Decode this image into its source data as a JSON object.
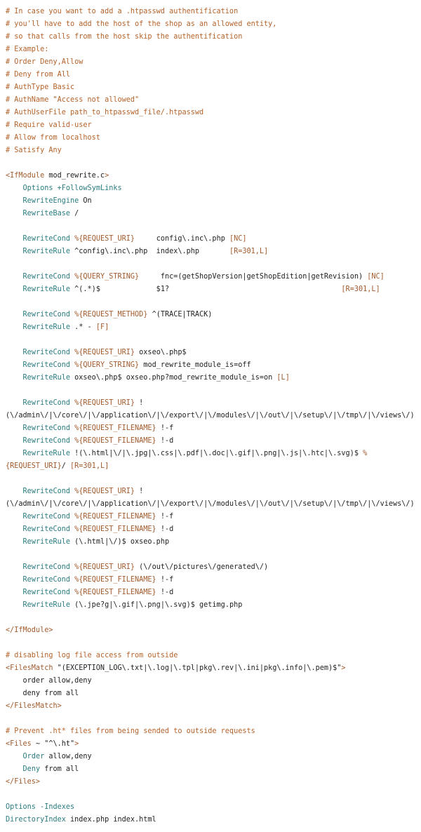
{
  "code_lines": [
    [
      [
        "c",
        "# In case you want to add a .htpasswd authentification"
      ]
    ],
    [
      [
        "c",
        "# you'll have to add the host of the shop as an allowed entity,"
      ]
    ],
    [
      [
        "c",
        "# so that calls from the host skip the authentification"
      ]
    ],
    [
      [
        "c",
        "# Example:"
      ]
    ],
    [
      [
        "c",
        "# Order Deny,Allow"
      ]
    ],
    [
      [
        "c",
        "# Deny from All"
      ]
    ],
    [
      [
        "c",
        "# AuthType Basic"
      ]
    ],
    [
      [
        "c",
        "# AuthName \"Access not allowed\""
      ]
    ],
    [
      [
        "c",
        "# AuthUserFile path_to_htpasswd_file/.htpasswd"
      ]
    ],
    [
      [
        "c",
        "# Require valid-user"
      ]
    ],
    [
      [
        "c",
        "# Allow from localhost"
      ]
    ],
    [
      [
        "c",
        "# Satisfy Any"
      ]
    ],
    [],
    [
      [
        "t",
        "<IfModule"
      ],
      [
        "p",
        " mod_rewrite.c"
      ],
      [
        "t",
        ">"
      ]
    ],
    [
      [
        "p",
        "    "
      ],
      [
        "d",
        "Options"
      ],
      [
        "p",
        " "
      ],
      [
        "d",
        "+FollowSymLinks"
      ]
    ],
    [
      [
        "p",
        "    "
      ],
      [
        "d",
        "RewriteEngine"
      ],
      [
        "p",
        " On"
      ]
    ],
    [
      [
        "p",
        "    "
      ],
      [
        "d",
        "RewriteBase"
      ],
      [
        "p",
        " /"
      ]
    ],
    [],
    [
      [
        "p",
        "    "
      ],
      [
        "d",
        "RewriteCond"
      ],
      [
        "p",
        " "
      ],
      [
        "v",
        "%{REQUEST_URI}"
      ],
      [
        "p",
        "     config\\.inc\\.php "
      ],
      [
        "v",
        "[NC]"
      ]
    ],
    [
      [
        "p",
        "    "
      ],
      [
        "d",
        "RewriteRule"
      ],
      [
        "p",
        " ^config\\.inc\\.php  index\\.php       "
      ],
      [
        "v",
        "[R=301,L]"
      ]
    ],
    [],
    [
      [
        "p",
        "    "
      ],
      [
        "d",
        "RewriteCond"
      ],
      [
        "p",
        " "
      ],
      [
        "v",
        "%{QUERY_STRING}"
      ],
      [
        "p",
        "     fnc=(getShopVersion|getShopEdition|getRevision) "
      ],
      [
        "v",
        "[NC]"
      ]
    ],
    [
      [
        "p",
        "    "
      ],
      [
        "d",
        "RewriteRule"
      ],
      [
        "p",
        " ^(.*)$             $1?                                        "
      ],
      [
        "v",
        "[R=301,L]"
      ]
    ],
    [],
    [
      [
        "p",
        "    "
      ],
      [
        "d",
        "RewriteCond"
      ],
      [
        "p",
        " "
      ],
      [
        "v",
        "%{REQUEST_METHOD}"
      ],
      [
        "p",
        " ^(TRACE|TRACK)"
      ]
    ],
    [
      [
        "p",
        "    "
      ],
      [
        "d",
        "RewriteRule"
      ],
      [
        "p",
        " .* - "
      ],
      [
        "v",
        "[F]"
      ]
    ],
    [],
    [
      [
        "p",
        "    "
      ],
      [
        "d",
        "RewriteCond"
      ],
      [
        "p",
        " "
      ],
      [
        "v",
        "%{REQUEST_URI}"
      ],
      [
        "p",
        " oxseo\\.php$"
      ]
    ],
    [
      [
        "p",
        "    "
      ],
      [
        "d",
        "RewriteCond"
      ],
      [
        "p",
        " "
      ],
      [
        "v",
        "%{QUERY_STRING}"
      ],
      [
        "p",
        " mod_rewrite_module_is=off"
      ]
    ],
    [
      [
        "p",
        "    "
      ],
      [
        "d",
        "RewriteRule"
      ],
      [
        "p",
        " oxseo\\.php$ oxseo.php?mod_rewrite_module_is=on "
      ],
      [
        "v",
        "[L]"
      ]
    ],
    [],
    [
      [
        "p",
        "    "
      ],
      [
        "d",
        "RewriteCond"
      ],
      [
        "p",
        " "
      ],
      [
        "v",
        "%{REQUEST_URI}"
      ],
      [
        "p",
        " !"
      ]
    ],
    [
      [
        "p",
        "(\\/admin\\/|\\/core\\/|\\/application\\/|\\/export\\/|\\/modules\\/|\\/out\\/|\\/setup\\/|\\/tmp\\/|\\/views\\/)"
      ]
    ],
    [
      [
        "p",
        "    "
      ],
      [
        "d",
        "RewriteCond"
      ],
      [
        "p",
        " "
      ],
      [
        "v",
        "%{REQUEST_FILENAME}"
      ],
      [
        "p",
        " !-f"
      ]
    ],
    [
      [
        "p",
        "    "
      ],
      [
        "d",
        "RewriteCond"
      ],
      [
        "p",
        " "
      ],
      [
        "v",
        "%{REQUEST_FILENAME}"
      ],
      [
        "p",
        " !-d"
      ]
    ],
    [
      [
        "p",
        "    "
      ],
      [
        "d",
        "RewriteRule"
      ],
      [
        "p",
        " !(\\.html|\\/|\\.jpg|\\.css|\\.pdf|\\.doc|\\.gif|\\.png|\\.js|\\.htc|\\.svg)$ "
      ],
      [
        "v",
        "%"
      ]
    ],
    [
      [
        "v",
        "{REQUEST_URI}"
      ],
      [
        "p",
        "/ "
      ],
      [
        "v",
        "[R=301,L]"
      ]
    ],
    [],
    [
      [
        "p",
        "    "
      ],
      [
        "d",
        "RewriteCond"
      ],
      [
        "p",
        " "
      ],
      [
        "v",
        "%{REQUEST_URI}"
      ],
      [
        "p",
        " !"
      ]
    ],
    [
      [
        "p",
        "(\\/admin\\/|\\/core\\/|\\/application\\/|\\/export\\/|\\/modules\\/|\\/out\\/|\\/setup\\/|\\/tmp\\/|\\/views\\/)"
      ]
    ],
    [
      [
        "p",
        "    "
      ],
      [
        "d",
        "RewriteCond"
      ],
      [
        "p",
        " "
      ],
      [
        "v",
        "%{REQUEST_FILENAME}"
      ],
      [
        "p",
        " !-f"
      ]
    ],
    [
      [
        "p",
        "    "
      ],
      [
        "d",
        "RewriteCond"
      ],
      [
        "p",
        " "
      ],
      [
        "v",
        "%{REQUEST_FILENAME}"
      ],
      [
        "p",
        " !-d"
      ]
    ],
    [
      [
        "p",
        "    "
      ],
      [
        "d",
        "RewriteRule"
      ],
      [
        "p",
        " (\\.html|\\/)$ oxseo.php"
      ]
    ],
    [],
    [
      [
        "p",
        "    "
      ],
      [
        "d",
        "RewriteCond"
      ],
      [
        "p",
        " "
      ],
      [
        "v",
        "%{REQUEST_URI}"
      ],
      [
        "p",
        " (\\/out\\/pictures\\/generated\\/)"
      ]
    ],
    [
      [
        "p",
        "    "
      ],
      [
        "d",
        "RewriteCond"
      ],
      [
        "p",
        " "
      ],
      [
        "v",
        "%{REQUEST_FILENAME}"
      ],
      [
        "p",
        " !-f"
      ]
    ],
    [
      [
        "p",
        "    "
      ],
      [
        "d",
        "RewriteCond"
      ],
      [
        "p",
        " "
      ],
      [
        "v",
        "%{REQUEST_FILENAME}"
      ],
      [
        "p",
        " !-d"
      ]
    ],
    [
      [
        "p",
        "    "
      ],
      [
        "d",
        "RewriteRule"
      ],
      [
        "p",
        " (\\.jpe?g|\\.gif|\\.png|\\.svg)$ getimg.php"
      ]
    ],
    [],
    [
      [
        "t",
        "</IfModule>"
      ]
    ],
    [],
    [
      [
        "c",
        "# disabling log file access from outside"
      ]
    ],
    [
      [
        "t",
        "<FilesMatch"
      ],
      [
        "p",
        " \"(EXCEPTION_LOG\\.txt|\\.log|\\.tpl|pkg\\.rev|\\.ini|pkg\\.info|\\.pem)$\""
      ],
      [
        "t",
        ">"
      ]
    ],
    [
      [
        "p",
        "    order allow,deny"
      ]
    ],
    [
      [
        "p",
        "    deny from all"
      ]
    ],
    [
      [
        "t",
        "</FilesMatch>"
      ]
    ],
    [],
    [
      [
        "c",
        "# Prevent .ht* files from being sended to outside requests"
      ]
    ],
    [
      [
        "t",
        "<Files"
      ],
      [
        "p",
        " ~ \"^\\.ht\""
      ],
      [
        "t",
        ">"
      ]
    ],
    [
      [
        "p",
        "    "
      ],
      [
        "d",
        "Order"
      ],
      [
        "p",
        " allow,deny"
      ]
    ],
    [
      [
        "p",
        "    "
      ],
      [
        "d",
        "Deny"
      ],
      [
        "p",
        " from all"
      ]
    ],
    [
      [
        "t",
        "</Files>"
      ]
    ],
    [],
    [
      [
        "d",
        "Options"
      ],
      [
        "p",
        " "
      ],
      [
        "d",
        "-Indexes"
      ]
    ],
    [
      [
        "d",
        "DirectoryIndex"
      ],
      [
        "p",
        " index.php index.html"
      ]
    ]
  ]
}
